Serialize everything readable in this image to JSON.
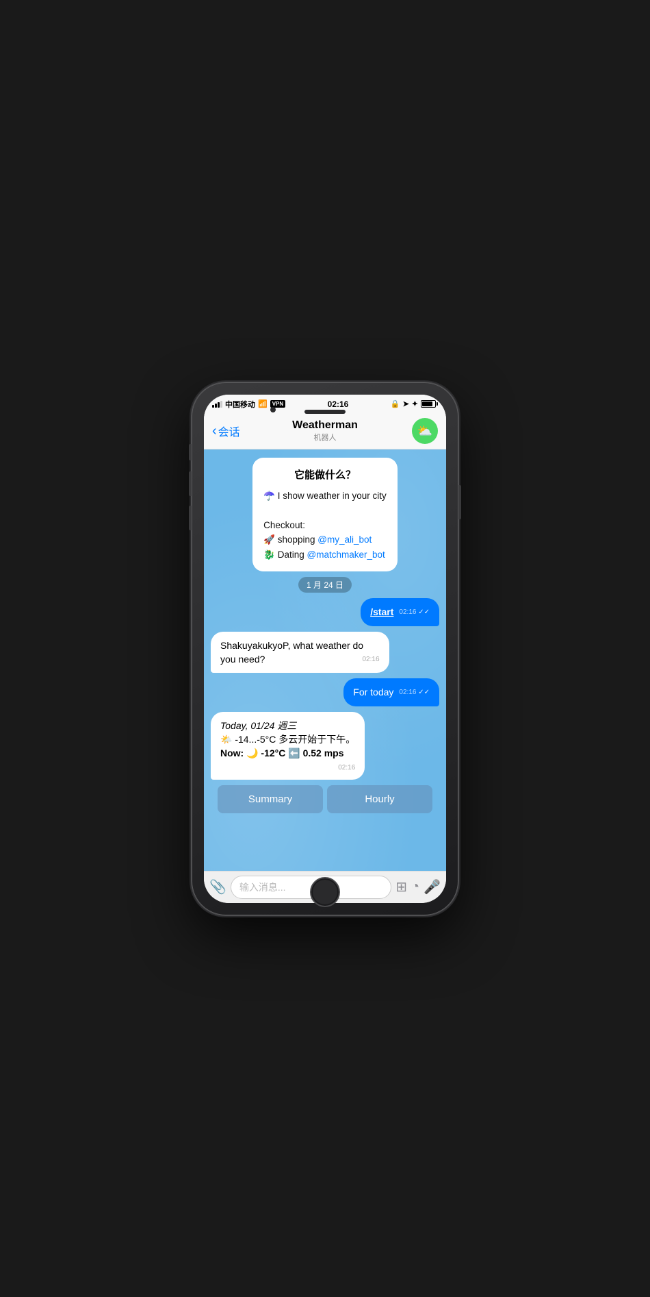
{
  "phone": {
    "statusBar": {
      "carrier": "中国移动",
      "wifi": "📶",
      "vpn": "VPN",
      "time": "02:16",
      "batteryLevel": "85%"
    },
    "navBar": {
      "backLabel": "会话",
      "botName": "Weatherman",
      "botSubtitle": "机器人",
      "botAvatar": "⛅"
    },
    "chat": {
      "welcomeTitle": "它能做什么？",
      "welcomeLine1": "☂️ I show weather in your city",
      "checkoutLabel": "Checkout:",
      "shoppingLink": "@my_ali_bot",
      "datingLink": "@matchmaker_bot",
      "dateBadge": "1 月 24 日",
      "userMsg1": "/start",
      "userMsg1Time": "02:16",
      "botReply1": "ShakuyakukyoP, what weather do you need?",
      "botReply1Time": "02:16",
      "userMsg2": "For today",
      "userMsg2Time": "02:16",
      "weatherDate": "Today, 01/24 週三",
      "weatherRange": "🌤️ -14...-5°C 多云开始于下午。",
      "weatherNow": "Now: 🌙 -12°C ⬅️ 0.52 mps",
      "weatherTime": "02:16",
      "btn1": "Summary",
      "btn2": "Hourly"
    },
    "inputBar": {
      "placeholder": "输入消息..."
    }
  }
}
